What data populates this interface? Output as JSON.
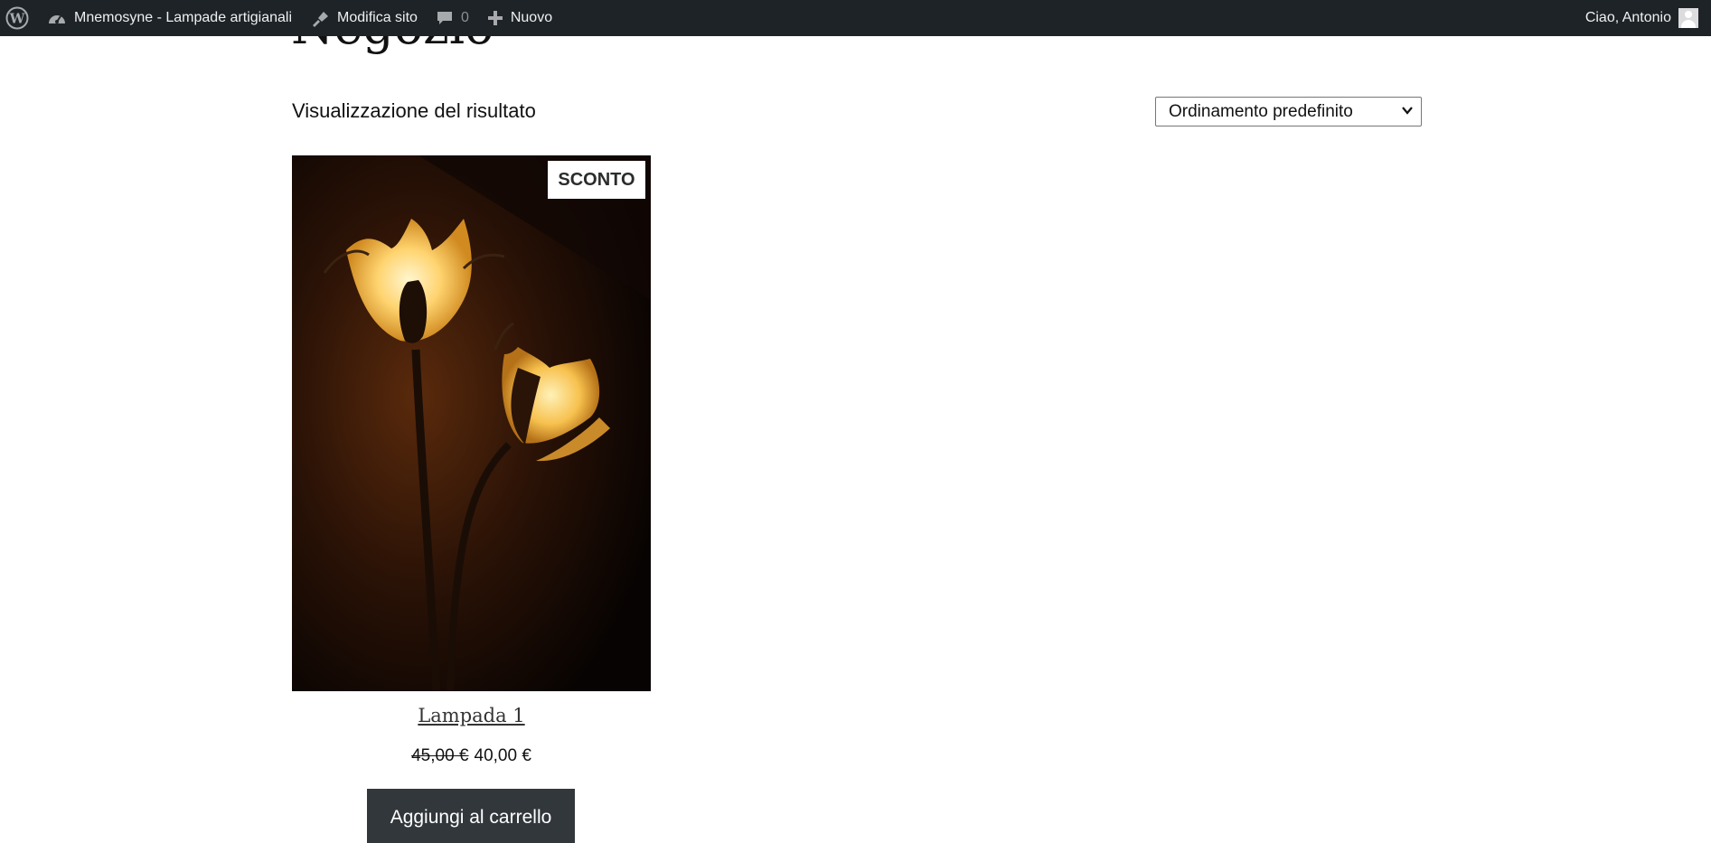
{
  "adminbar": {
    "site_name": "Mnemosyne - Lampade artigianali",
    "edit_site": "Modifica sito",
    "comments_count": "0",
    "new_label": "Nuovo",
    "greeting": "Ciao, Antonio"
  },
  "main": {
    "page_title": "Negozio",
    "result_count": "Visualizzazione del risultato",
    "ordering_selected": "Ordinamento predefinito"
  },
  "product": {
    "badge": "SCONTO",
    "title": "Lampada 1",
    "price_old": "45,00 €",
    "price_new": "40,00 €",
    "add_to_cart": "Aggiungi al carrello"
  },
  "colors": {
    "adminbar_bg": "#1d2327",
    "button_bg": "#32373c"
  },
  "icons": {
    "wordpress": "wordpress-logo-icon",
    "site": "dashboard-icon",
    "edit": "paintbrush-icon",
    "comments": "comment-bubble-icon",
    "new": "plus-icon",
    "avatar": "user-avatar-icon",
    "select": "chevron-down-icon"
  }
}
